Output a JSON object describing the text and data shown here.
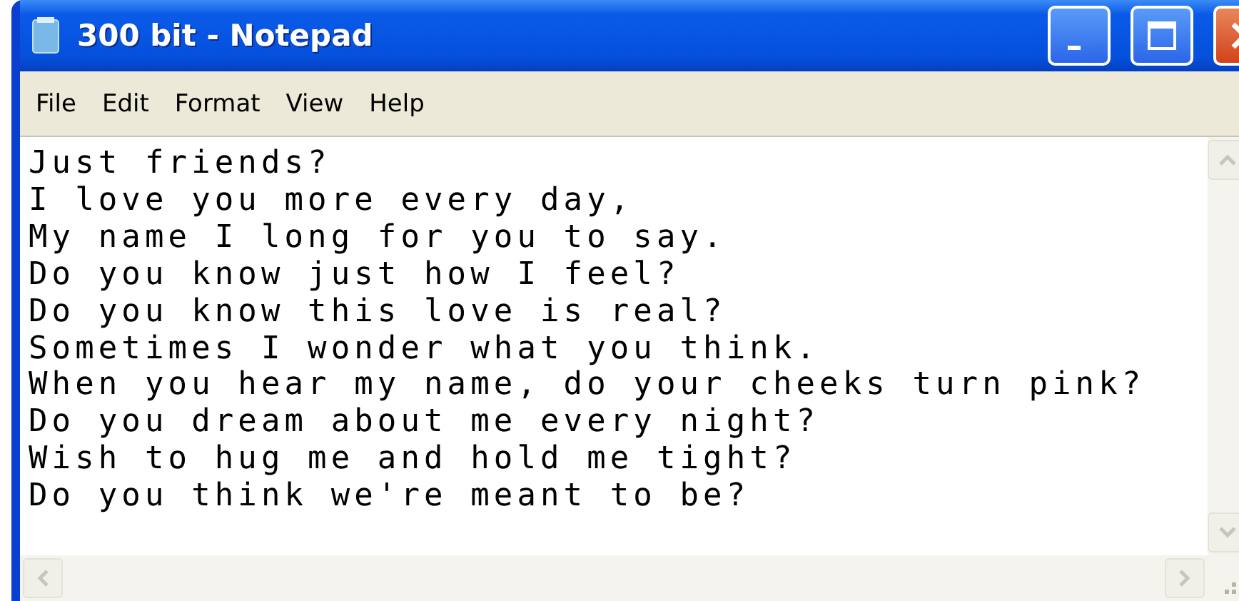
{
  "window": {
    "title": "300 bit - Notepad"
  },
  "menu": [
    "File",
    "Edit",
    "Format",
    "View",
    "Help"
  ],
  "document": {
    "lines": [
      "Just friends?",
      "I love you more every day,",
      "My name I long for you to say.",
      "Do you know just how I feel?",
      "Do you know this love is real?",
      "Sometimes I wonder what you think.",
      "When you hear my name, do your cheeks turn pink?",
      "Do you dream about me every night?",
      "Wish to hug me and hold me tight?",
      "Do you think we're meant to be?"
    ]
  }
}
